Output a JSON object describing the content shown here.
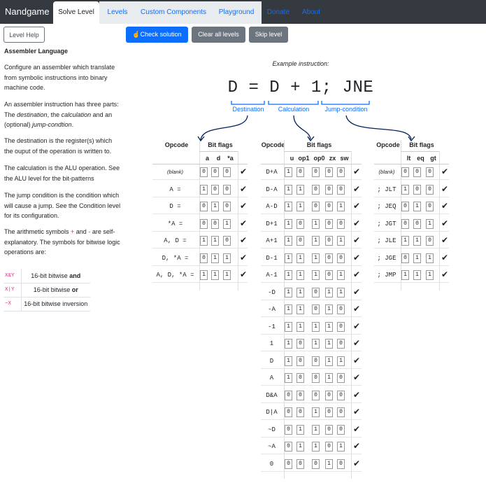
{
  "nav": {
    "brand": "Nandgame",
    "tabs": [
      "Solve Level",
      "Levels",
      "Custom Components",
      "Playground",
      "Donate",
      "About"
    ]
  },
  "toolbar": {
    "help": "Level Help",
    "check": "Check solution",
    "clear": "Clear all levels",
    "skip": "Skip level"
  },
  "side": {
    "title": "Assembler Language",
    "p1": "Configure an assembler which translate from symbolic instructions into binary machine code.",
    "p2a": "An assembler instruction has three parts: The ",
    "p2b": "destination",
    "p2c": ", the ",
    "p2d": "calculation",
    "p2e": " and an (optional) ",
    "p2f": "jump-condtion",
    "p2g": ".",
    "p3": "The destination is the register(s) which the ouput of the operation is written to.",
    "p4": "The calculation is the ALU operation. See the ALU level for the bit-patterns",
    "p5": "The jump condition is the condition which will cause a jump. See the Condition level for its configuration.",
    "p6a": "The arithmetic symbols ",
    "p6b": "+",
    "p6c": " and ",
    "p6d": "-",
    "p6e": " are self-explanatory. The symbols for bitwise logic operations are:",
    "legend": [
      {
        "sym": "X&Y",
        "pre": "16-bit bitwise ",
        "bold": "and"
      },
      {
        "sym": "X|Y",
        "pre": "16-bit bitwise ",
        "bold": "or"
      },
      {
        "sym": "~X",
        "pre": "16-bit bitwise inversion",
        "bold": ""
      }
    ]
  },
  "example": {
    "label": "Example instruction:",
    "instruction": "D = D + 1; JNE",
    "parts": [
      "Destination",
      "Calculation",
      "Jump-condition"
    ]
  },
  "dest": {
    "h_op": "Opcode",
    "h_bits": "Bit flags",
    "cols": [
      "a",
      "d",
      "*a"
    ],
    "rows": [
      {
        "op": "(blank)",
        "bits": "000"
      },
      {
        "op": "A =",
        "bits": "100"
      },
      {
        "op": "D =",
        "bits": "010"
      },
      {
        "op": "*A =",
        "bits": "001"
      },
      {
        "op": "A, D =",
        "bits": "110"
      },
      {
        "op": "D, *A =",
        "bits": "011"
      },
      {
        "op": "A, D, *A =",
        "bits": "111"
      }
    ]
  },
  "calc": {
    "h_op": "Opcode",
    "h_bits": "Bit flags",
    "cols": [
      "u",
      "op1",
      "op0",
      "zx",
      "sw"
    ],
    "rows": [
      {
        "op": "D+A",
        "bits": "10000"
      },
      {
        "op": "D-A",
        "bits": "11000"
      },
      {
        "op": "A-D",
        "bits": "11001"
      },
      {
        "op": "D+1",
        "bits": "10100"
      },
      {
        "op": "A+1",
        "bits": "10101"
      },
      {
        "op": "D-1",
        "bits": "11100"
      },
      {
        "op": "A-1",
        "bits": "11101"
      },
      {
        "op": "-D",
        "bits": "11011"
      },
      {
        "op": "-A",
        "bits": "11010"
      },
      {
        "op": "-1",
        "bits": "11110"
      },
      {
        "op": "1",
        "bits": "10110"
      },
      {
        "op": "D",
        "bits": "10011"
      },
      {
        "op": "A",
        "bits": "10010"
      },
      {
        "op": "D&A",
        "bits": "00000"
      },
      {
        "op": "D|A",
        "bits": "00100"
      },
      {
        "op": "~D",
        "bits": "01100"
      },
      {
        "op": "~A",
        "bits": "01101"
      },
      {
        "op": "0",
        "bits": "00010"
      }
    ]
  },
  "jump": {
    "h_op": "Opcode",
    "h_bits": "Bit flags",
    "cols": [
      "lt",
      "eq",
      "gt"
    ],
    "rows": [
      {
        "op": "(blank)",
        "bits": "000"
      },
      {
        "op": "; JLT",
        "bits": "100"
      },
      {
        "op": "; JEQ",
        "bits": "010"
      },
      {
        "op": "; JGT",
        "bits": "001"
      },
      {
        "op": "; JLE",
        "bits": "110"
      },
      {
        "op": "; JGE",
        "bits": "011"
      },
      {
        "op": "; JMP",
        "bits": "111"
      }
    ]
  },
  "colors": {
    "nav": "#343a40",
    "primary": "#0d6efd",
    "secondary": "#6c757d",
    "pink": "#d63384"
  }
}
